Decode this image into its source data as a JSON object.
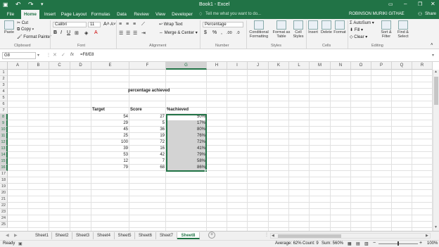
{
  "window": {
    "title": "Book1 - Excel",
    "user": "ROBINSON MURIKI GITHAE",
    "share": "Share",
    "save_icon": "save-icon",
    "undo_icon": "undo-icon",
    "redo_icon": "redo-icon"
  },
  "tabs": [
    "File",
    "Home",
    "Insert",
    "Page Layout",
    "Formulas",
    "Data",
    "Review",
    "View",
    "Developer"
  ],
  "tell_me": "Tell me what you want to do...",
  "ribbon": {
    "clipboard": {
      "paste": "Paste",
      "cut": "Cut",
      "copy": "Copy",
      "format_painter": "Format Painter",
      "label": "Clipboard"
    },
    "font": {
      "name": "Calibri",
      "size": "11",
      "label": "Font",
      "bold": "B",
      "italic": "I",
      "underline": "U",
      "grow": "A",
      "shrink": "A"
    },
    "alignment": {
      "wrap": "Wrap Text",
      "merge": "Merge & Center",
      "label": "Alignment"
    },
    "number": {
      "format": "Percentage",
      "currency": "$",
      "percent": "%",
      "comma": ",",
      "inc_dec": ".00",
      "dec_dec": ".0",
      "label": "Number"
    },
    "styles": {
      "conditional": "Conditional Formatting",
      "format_table": "Format as Table",
      "cell_styles": "Cell Styles",
      "label": "Styles"
    },
    "cells": {
      "insert": "Insert",
      "delete": "Delete",
      "format": "Format",
      "label": "Cells"
    },
    "editing": {
      "autosum": "AutoSum",
      "fill": "Fill",
      "clear": "Clear",
      "sort": "Sort & Filter",
      "find": "Find & Select",
      "label": "Editing"
    }
  },
  "formula_bar": {
    "name_box": "G8",
    "fx": "fx",
    "formula": "=F8/E8"
  },
  "columns": [
    "A",
    "B",
    "C",
    "D",
    "E",
    "F",
    "G",
    "H",
    "I",
    "J",
    "K",
    "L",
    "M",
    "N",
    "O",
    "P",
    "Q",
    "R"
  ],
  "rows": [
    "1",
    "2",
    "3",
    "4",
    "5",
    "6",
    "7",
    "8",
    "9",
    "10",
    "11",
    "12",
    "13",
    "14",
    "15",
    "16",
    "17",
    "18",
    "19",
    "20",
    "21",
    "22",
    "23",
    "24",
    "25"
  ],
  "sheet": {
    "heading": "percentage achieved",
    "headers": {
      "target": "Target",
      "score": "Score",
      "achieved": "%achieved"
    },
    "data": [
      {
        "target": "54",
        "score": "27",
        "achieved": "50%"
      },
      {
        "target": "29",
        "score": "5",
        "achieved": "17%"
      },
      {
        "target": "45",
        "score": "36",
        "achieved": "80%"
      },
      {
        "target": "25",
        "score": "19",
        "achieved": "76%"
      },
      {
        "target": "100",
        "score": "72",
        "achieved": "72%"
      },
      {
        "target": "39",
        "score": "16",
        "achieved": "41%"
      },
      {
        "target": "53",
        "score": "42",
        "achieved": "79%"
      },
      {
        "target": "12",
        "score": "7",
        "achieved": "58%"
      },
      {
        "target": "79",
        "score": "68",
        "achieved": "86%"
      }
    ]
  },
  "sheet_tabs": [
    "Sheet1",
    "Sheet2",
    "Sheet3",
    "Sheet4",
    "Sheet5",
    "Sheet6",
    "Sheet7",
    "Sheet8"
  ],
  "active_sheet": "Sheet8",
  "add_sheet": "+",
  "status": {
    "ready": "Ready",
    "average": "Average: 62%",
    "count": "Count: 9",
    "sum": "Sum: 560%",
    "zoom": "100%",
    "zoom_minus": "−",
    "zoom_plus": "+"
  },
  "colors": {
    "brand": "#217346",
    "selection": "#d3d3d3"
  }
}
